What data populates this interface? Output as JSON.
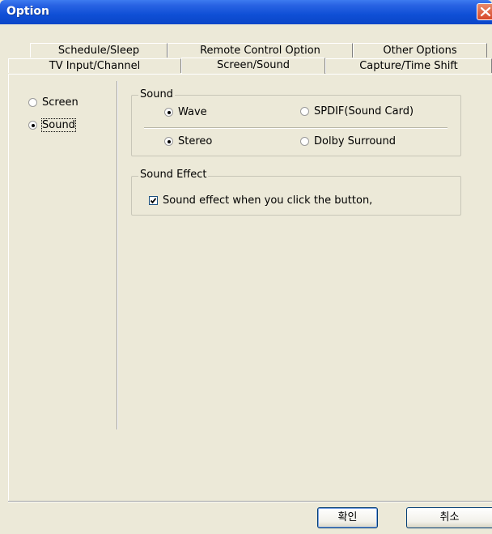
{
  "window": {
    "title": "Option"
  },
  "tabs": {
    "row_top": [
      "Schedule/Sleep",
      "Remote Control Option",
      "Other Options"
    ],
    "row_bottom": [
      "TV Input/Channel",
      "Screen/Sound",
      "Capture/Time Shift"
    ],
    "active": "Screen/Sound"
  },
  "left_options": [
    {
      "label": "Screen",
      "checked": false
    },
    {
      "label": "Sound",
      "checked": true
    }
  ],
  "sound_group": {
    "title": "Sound",
    "output": {
      "wave": "Wave",
      "spdif": "SPDIF(Sound Card)",
      "selected": "Wave"
    },
    "mode": {
      "stereo": "Stereo",
      "dolby": "Dolby Surround",
      "selected": "Stereo"
    }
  },
  "effect_group": {
    "title": "Sound Effect",
    "checkbox_label": "Sound effect when you click the button,",
    "checked": true
  },
  "buttons": {
    "ok": "확인",
    "cancel": "취소"
  },
  "colors": {
    "title_bar": "#0f4fd6",
    "dialog_bg": "#ece9d8",
    "close_button": "#d6472a"
  }
}
